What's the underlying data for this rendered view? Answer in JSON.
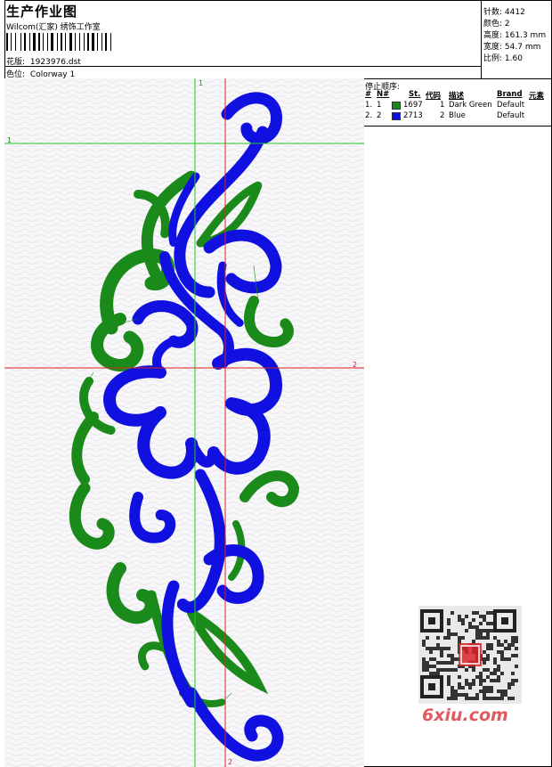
{
  "header": {
    "title": "生产作业图",
    "software": "Wilcom(汇家) 绣饰工作室",
    "design_label": "花版:",
    "design_file": "1923976.dst",
    "colorway_label": "色位:",
    "colorway": "Colorway 1"
  },
  "stats": [
    {
      "label": "针数:",
      "value": "4412"
    },
    {
      "label": "颜色:",
      "value": "2"
    },
    {
      "label": "高度:",
      "value": "161.3 mm"
    },
    {
      "label": "宽度:",
      "value": "54.7 mm"
    },
    {
      "label": "比例:",
      "value": "1.60"
    }
  ],
  "sequence": {
    "title": "停止顺序:",
    "columns": [
      "#",
      "N#",
      "St.",
      "代码",
      "描述",
      "Brand",
      "元素"
    ],
    "rows": [
      {
        "idx": "1.",
        "n": "1",
        "color": "#1a8a1a",
        "stitches": "1697",
        "code": "1",
        "desc": "Dark Green",
        "brand": "Default"
      },
      {
        "idx": "2.",
        "n": "2",
        "color": "#1010e0",
        "stitches": "2713",
        "code": "2",
        "desc": "Blue",
        "brand": "Default"
      }
    ]
  },
  "guides": {
    "green_v": "1",
    "green_h": "1",
    "red_v": "2",
    "red_h": "2"
  },
  "colors": {
    "green": "#1a8a1a",
    "blue": "#1010e0",
    "guide_green": "#22cc22",
    "guide_red": "#dd2222",
    "watermark_red": "#d8232a"
  },
  "watermark": {
    "text": "6xiu.com"
  }
}
